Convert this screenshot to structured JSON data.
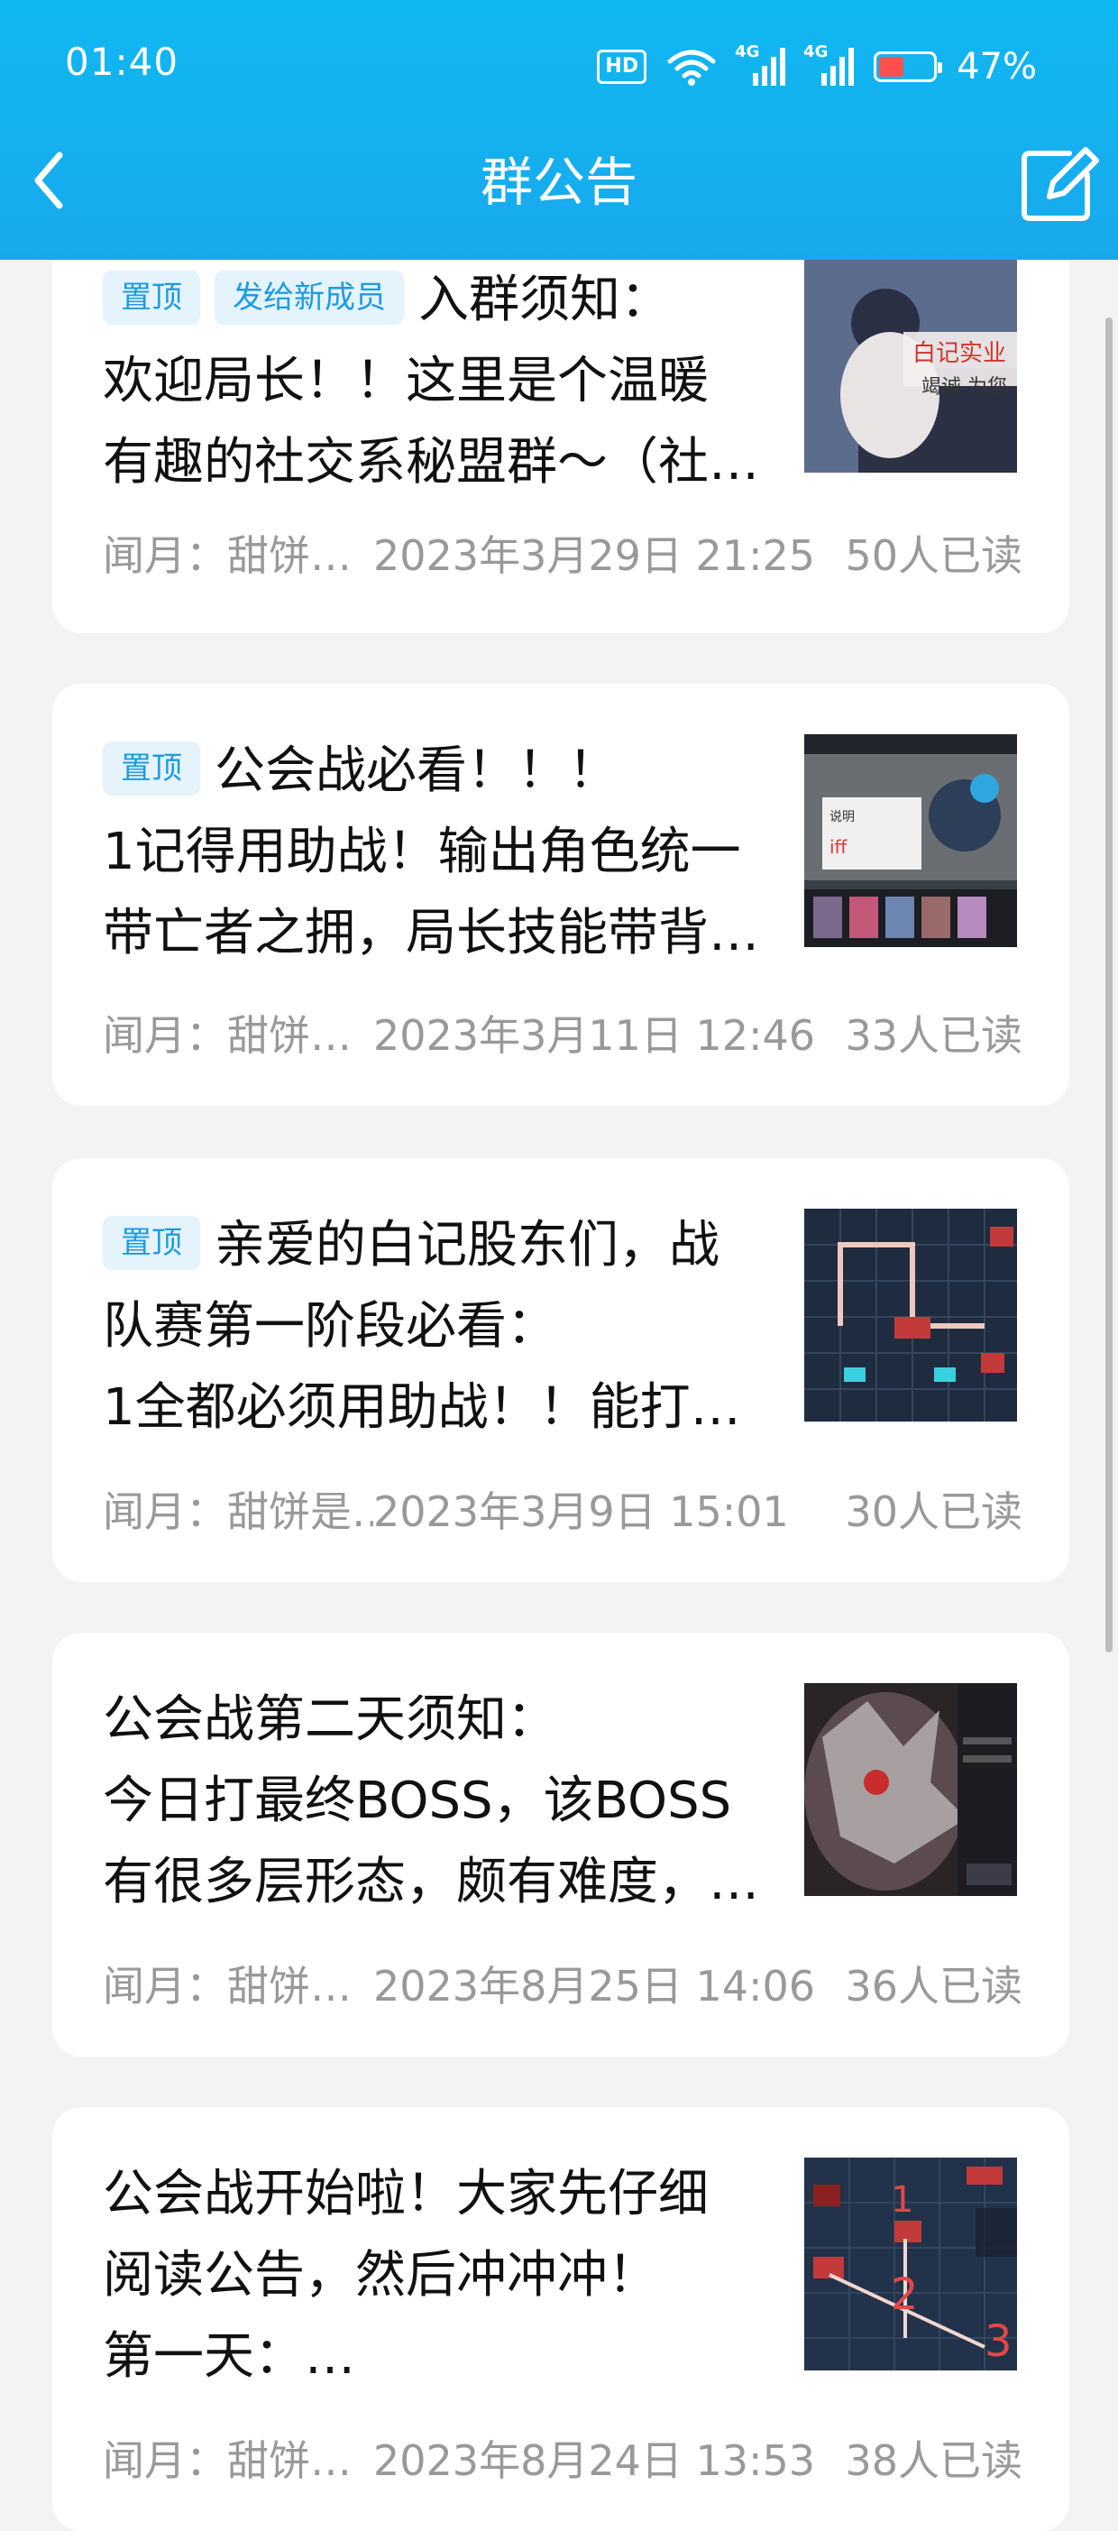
{
  "status_bar": {
    "time": "01:40",
    "hd": "HD",
    "network1": "4G",
    "network2": "4G",
    "battery_level": 0.47,
    "battery_text": "47%"
  },
  "header": {
    "title": "群公告"
  },
  "announcements": [
    {
      "tags": [
        "置顶",
        "发给新成员"
      ],
      "lines": [
        "入群须知：",
        "欢迎局长！！这里是个温暖",
        "有趣的社交系秘盟群～（社…"
      ],
      "author": "闻月：甜饼…",
      "date": "2023年3月29日 21:25",
      "reads": "50人已读",
      "thumb": "anime-character-banner"
    },
    {
      "tags": [
        "置顶"
      ],
      "lines": [
        "公会战必看！！！",
        "1记得用助战！输出角色统一",
        "带亡者之拥，局长技能带背…"
      ],
      "author": "闻月：甜饼…",
      "date": "2023年3月11日 12:46",
      "reads": "33人已读",
      "thumb": "game-battle-screenshot"
    },
    {
      "tags": [
        "置顶"
      ],
      "lines": [
        "亲爱的白记股东们，战",
        "队赛第一阶段必看：",
        "1全都必须用助战！！能打…"
      ],
      "author": "闻月：甜饼是…",
      "date": "2023年3月9日 15:01",
      "reads": "30人已读",
      "thumb": "map-grid-screenshot"
    },
    {
      "tags": [],
      "lines": [
        "公会战第二天须知：",
        "今日打最终BOSS，该BOSS",
        "有很多层形态，颇有难度，…"
      ],
      "author": "闻月：甜饼…",
      "date": "2023年8月25日 14:06",
      "reads": "36人已读",
      "thumb": "boss-screenshot"
    },
    {
      "tags": [],
      "lines": [
        "公会战开始啦！大家先仔细",
        "阅读公告，然后冲冲冲！",
        "第一天：…"
      ],
      "author": "闻月：甜饼…",
      "date": "2023年8月24日 13:53",
      "reads": "38人已读",
      "thumb": "map-route-screenshot"
    }
  ]
}
